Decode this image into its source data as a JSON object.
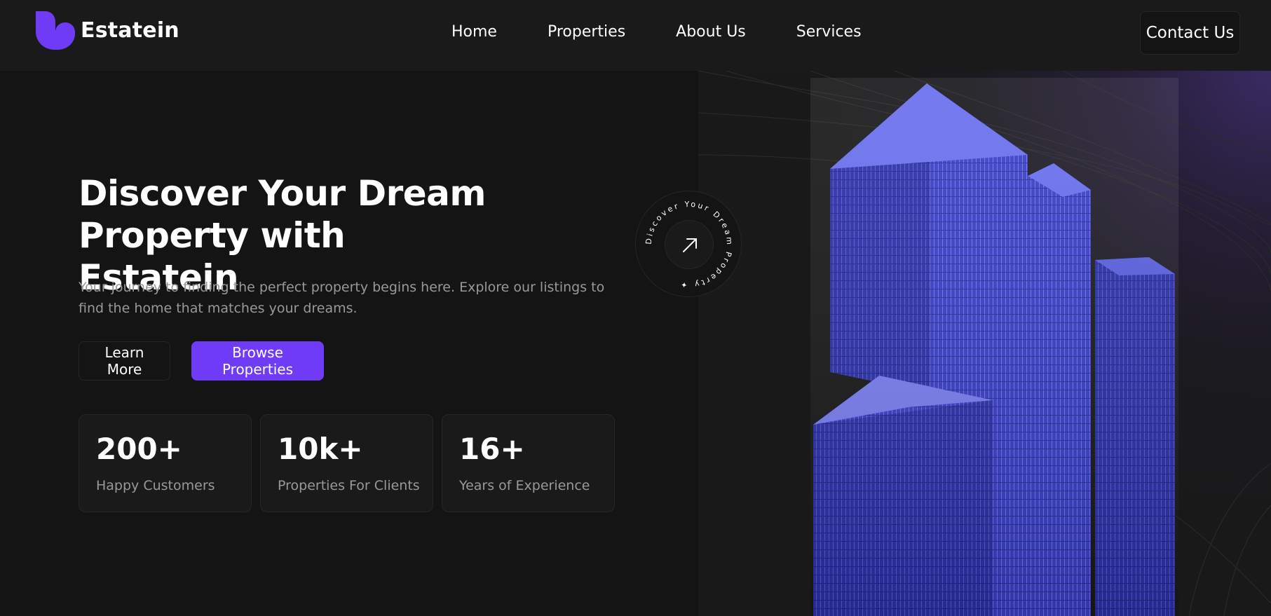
{
  "header": {
    "brand": "Estatein",
    "nav": [
      "Home",
      "Properties",
      "About Us",
      "Services"
    ],
    "contact_label": "Contact Us"
  },
  "hero": {
    "title_line1": "Discover Your Dream",
    "title_line2": "Property with Estatein",
    "subtitle": "Your journey to finding the perfect property begins here. Explore our listings to find the home that matches your dreams.",
    "learn_more": "Learn More",
    "browse": "Browse Properties",
    "badge_text": "Discover Your Dream Property ✦",
    "stats": [
      {
        "value": "200+",
        "label": "Happy Customers"
      },
      {
        "value": "10k+",
        "label": "Properties For Clients"
      },
      {
        "value": "16+",
        "label": "Years of Experience"
      }
    ]
  },
  "colors": {
    "accent": "#703bf7",
    "background": "#141414",
    "header": "#1a1a1a",
    "muted_text": "#999999"
  },
  "icons": {
    "logo": "estatein-logo-icon",
    "badge_arrow": "arrow-up-right-icon"
  }
}
